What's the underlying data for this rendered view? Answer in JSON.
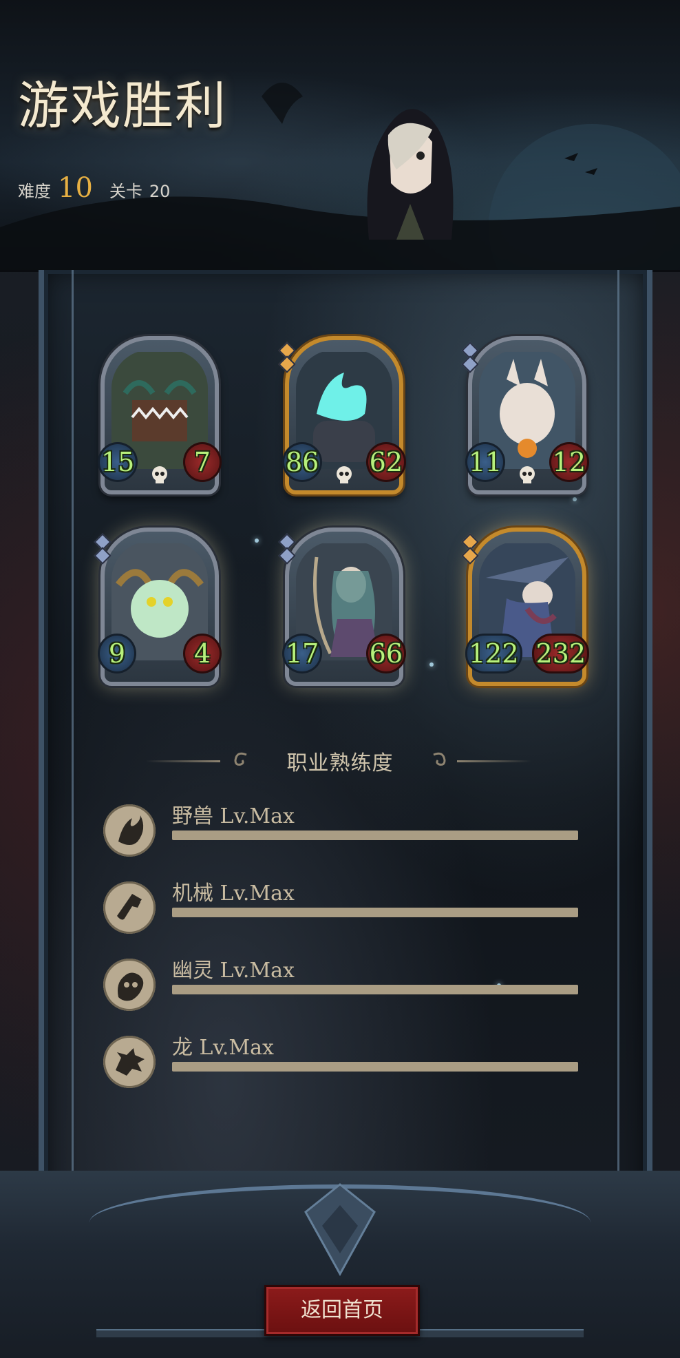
{
  "header": {
    "title": "游戏胜利",
    "difficulty_label": "难度",
    "difficulty_value": "10",
    "stage_label": "关卡",
    "stage_value": "20"
  },
  "team": [
    {
      "name_icon": "chest-monster",
      "attack": "15",
      "health": "7",
      "frame": "silver",
      "glow": false,
      "gems": 0
    },
    {
      "name_icon": "ghost-flame-beast",
      "attack": "86",
      "health": "62",
      "frame": "gold",
      "glow": false,
      "gems": 2
    },
    {
      "name_icon": "zombie-rabbit",
      "attack": "11",
      "health": "12",
      "frame": "silver",
      "glow": false,
      "gems": 2
    },
    {
      "name_icon": "clock-dragon",
      "attack": "9",
      "health": "4",
      "frame": "silver",
      "glow": true,
      "gems": 2
    },
    {
      "name_icon": "harp-ghost-lady",
      "attack": "17",
      "health": "66",
      "frame": "silver",
      "glow": true,
      "gems": 2
    },
    {
      "name_icon": "old-wizard",
      "attack": "122",
      "health": "232",
      "frame": "gold",
      "glow": true,
      "gems": 2
    }
  ],
  "mastery": {
    "title": "职业熟练度",
    "rows": [
      {
        "label": "野兽 Lv.Max",
        "icon": "beast-claw-icon",
        "progress": 1.0
      },
      {
        "label": "机械 Lv.Max",
        "icon": "mech-icon",
        "progress": 1.0
      },
      {
        "label": "幽灵 Lv.Max",
        "icon": "ghost-icon",
        "progress": 1.0
      },
      {
        "label": "龙 Lv.Max",
        "icon": "dragon-icon",
        "progress": 1.0
      }
    ]
  },
  "buttons": {
    "back_home": "返回首页"
  },
  "colors": {
    "title": "#f4e9cf",
    "difficulty": "#e7b043",
    "attack_text": "#b7f17c",
    "button_bg": "#8c1b1b",
    "mastery_bar": "#aa9d84"
  }
}
